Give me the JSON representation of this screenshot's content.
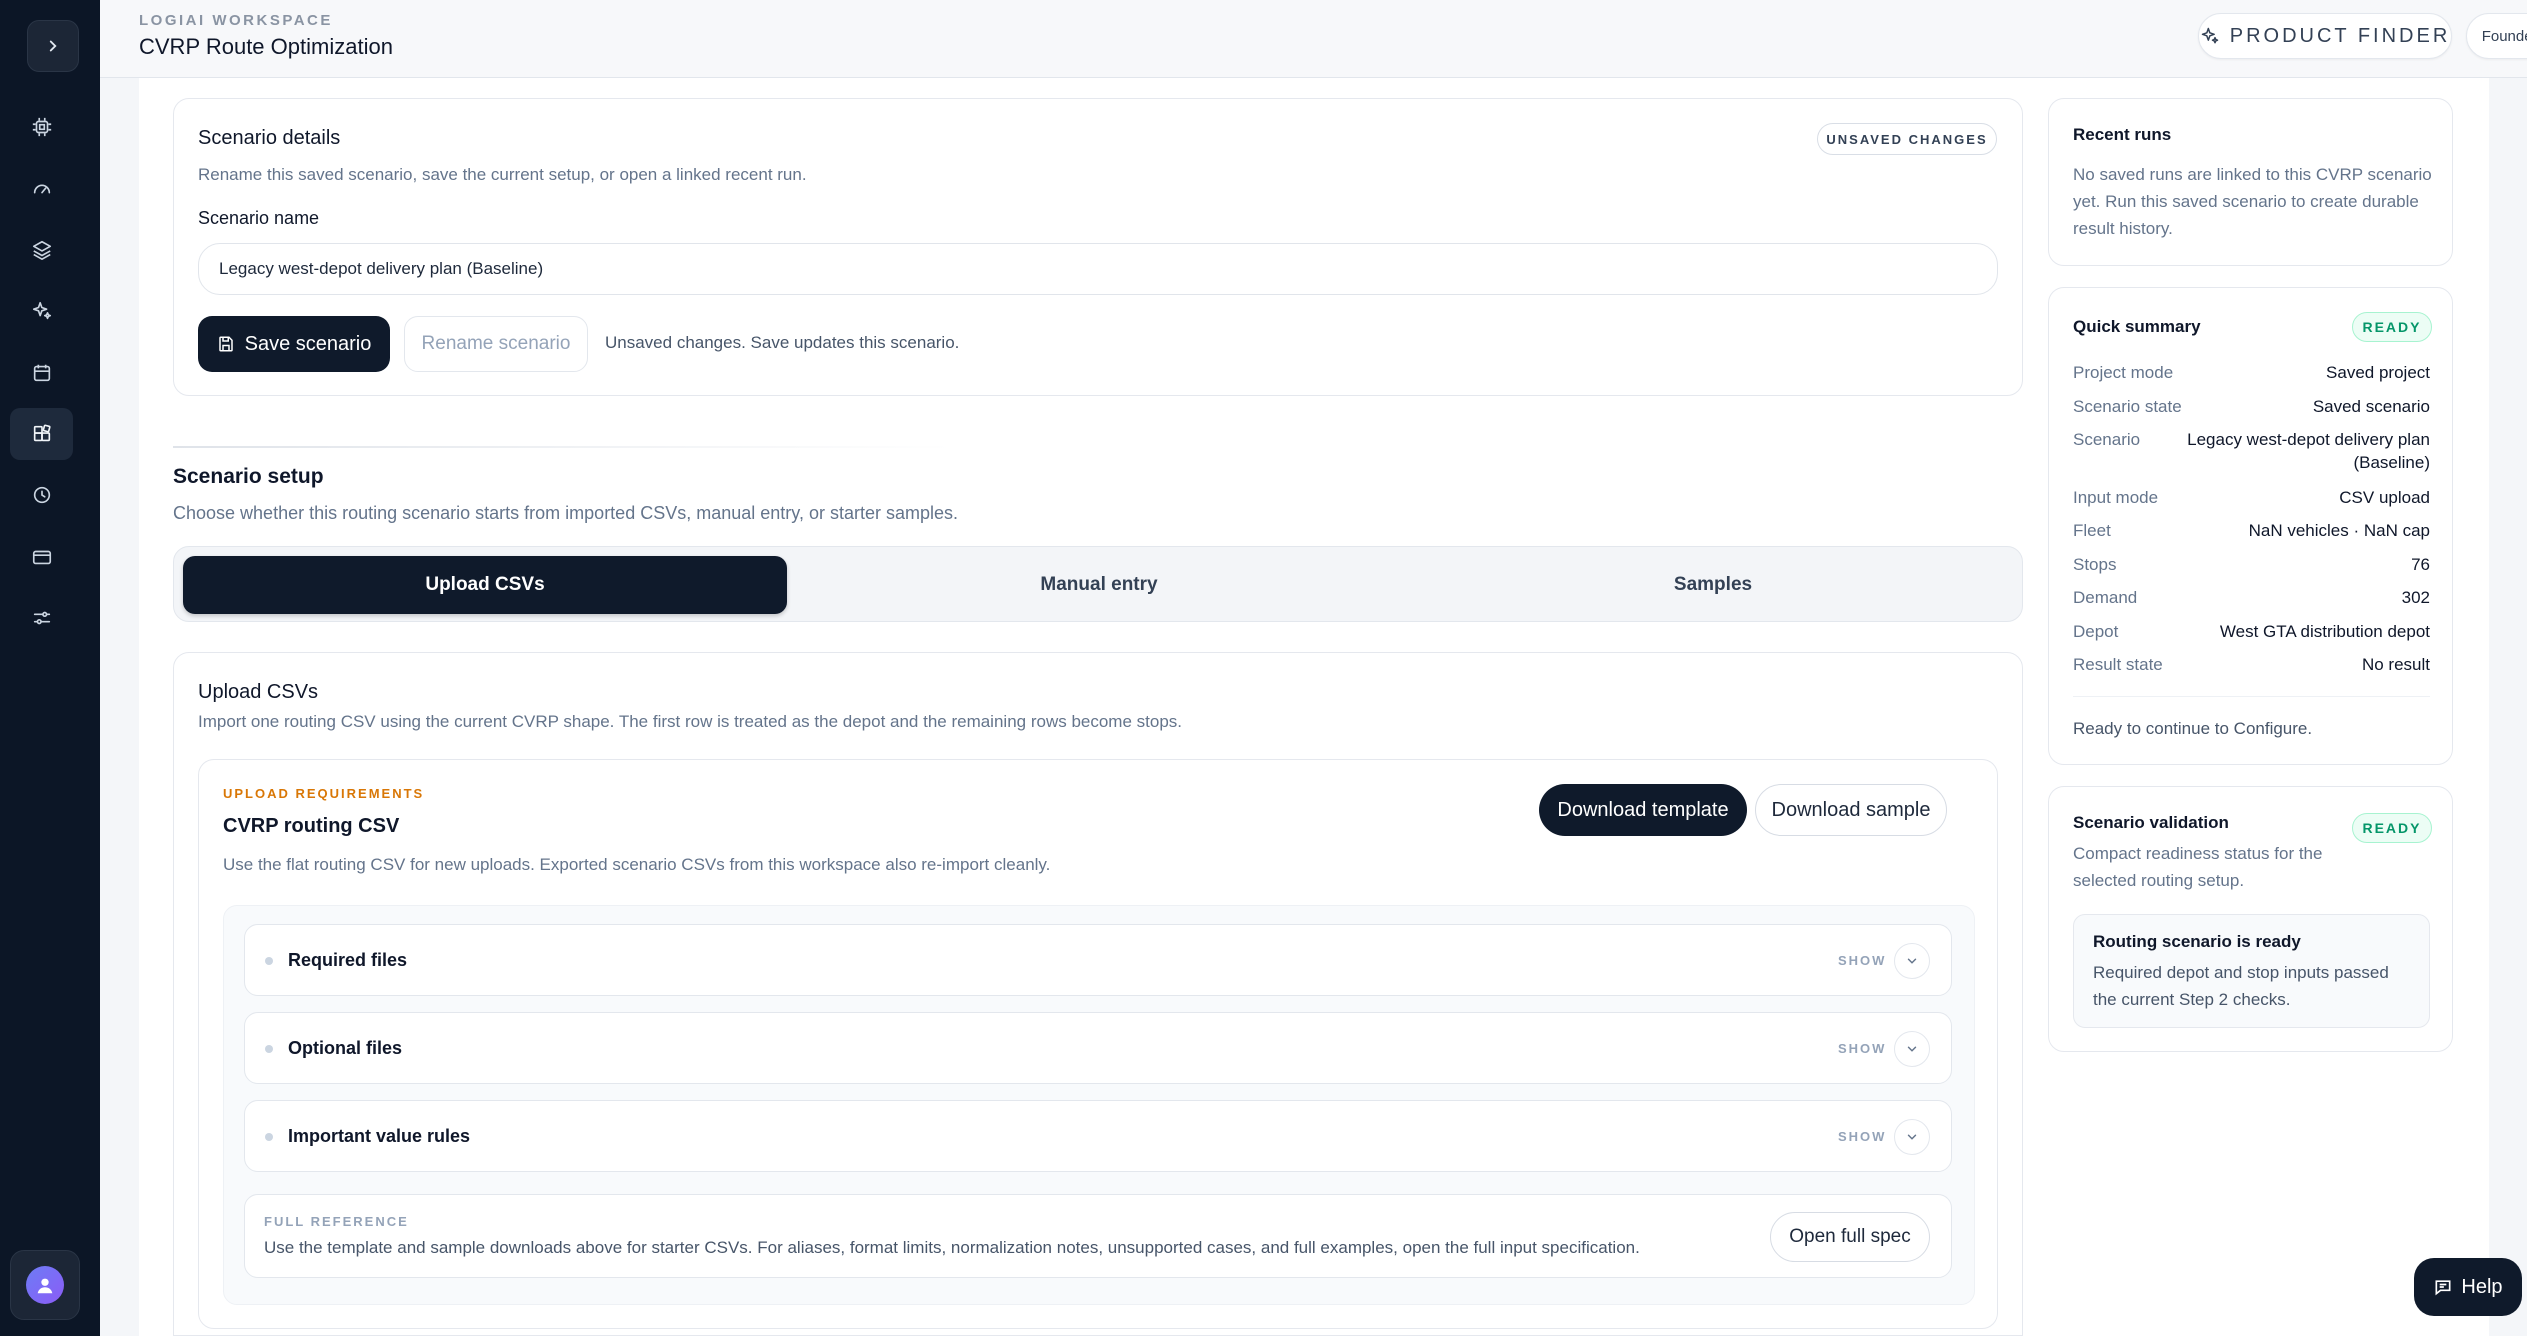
{
  "header": {
    "eyebrow": "LOGIAI WORKSPACE",
    "title": "CVRP Route Optimization",
    "product_finder": "PRODUCT FINDER",
    "account": "Founder account"
  },
  "sidebar": {
    "items": [
      "cpu-icon",
      "gauge-icon",
      "layers-icon",
      "sparkles-icon",
      "calendar-icon",
      "blocks-icon",
      "gear-chart-icon",
      "card-icon",
      "sliders-icon"
    ],
    "active_index": 5
  },
  "scenario_details": {
    "title": "Scenario details",
    "badge": "UNSAVED CHANGES",
    "description": "Rename this saved scenario, save the current setup, or open a linked recent run.",
    "name_label": "Scenario name",
    "name_value": "Legacy west-depot delivery plan (Baseline)",
    "save_label": "Save scenario",
    "rename_label": "Rename scenario",
    "status_text": "Unsaved changes. Save updates this scenario."
  },
  "scenario_setup": {
    "title": "Scenario setup",
    "description": "Choose whether this routing scenario starts from imported CSVs, manual entry, or starter samples.",
    "tabs": [
      {
        "label": "Upload CSVs",
        "active": true
      },
      {
        "label": "Manual entry",
        "active": false
      },
      {
        "label": "Samples",
        "active": false
      }
    ]
  },
  "upload": {
    "title": "Upload CSVs",
    "description": "Import one routing CSV using the current CVRP shape. The first row is treated as the depot and the remaining rows become stops.",
    "req_eyebrow": "UPLOAD REQUIREMENTS",
    "req_title": "CVRP routing CSV",
    "req_description": "Use the flat routing CSV for new uploads. Exported scenario CSVs from this workspace also re-import cleanly.",
    "download_template": "Download template",
    "download_sample": "Download sample",
    "accordions": [
      {
        "label": "Required files",
        "toggle": "SHOW"
      },
      {
        "label": "Optional files",
        "toggle": "SHOW"
      },
      {
        "label": "Important value rules",
        "toggle": "SHOW"
      }
    ],
    "reference_eyebrow": "FULL REFERENCE",
    "reference_text": "Use the template and sample downloads above for starter CSVs. For aliases, format limits, normalization notes, unsupported cases, and full examples, open the full input specification.",
    "open_spec": "Open full spec"
  },
  "recent_runs": {
    "title": "Recent runs",
    "text": "No saved runs are linked to this CVRP scenario yet. Run this saved scenario to create durable result history."
  },
  "quick_summary": {
    "title": "Quick summary",
    "badge": "READY",
    "rows": [
      {
        "k": "Project mode",
        "v": "Saved project"
      },
      {
        "k": "Scenario state",
        "v": "Saved scenario"
      },
      {
        "k": "Scenario",
        "v": "Legacy west-depot delivery plan",
        "v2": "(Baseline)"
      },
      {
        "k": "Input mode",
        "v": "CSV upload"
      },
      {
        "k": "Fleet",
        "v": "NaN vehicles · NaN cap"
      },
      {
        "k": "Stops",
        "v": "76"
      },
      {
        "k": "Demand",
        "v": "302"
      },
      {
        "k": "Depot",
        "v": "West GTA distribution depot"
      },
      {
        "k": "Result state",
        "v": "No result"
      }
    ],
    "footer": "Ready to continue to Configure."
  },
  "validation": {
    "title": "Scenario validation",
    "badge": "READY",
    "description_1": "Compact readiness status for the",
    "description_2": "selected routing setup.",
    "box_title": "Routing scenario is ready",
    "box_text_1": "Required depot and stop inputs passed",
    "box_text_2": "the current Step 2 checks."
  },
  "help": {
    "label": "Help"
  }
}
